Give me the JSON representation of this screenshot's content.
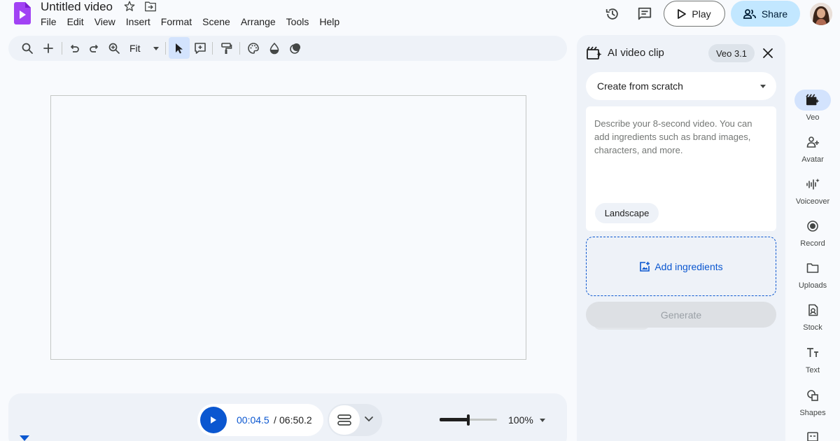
{
  "document": {
    "title": "Untitled video"
  },
  "menu": [
    "File",
    "Edit",
    "View",
    "Insert",
    "Format",
    "Scene",
    "Arrange",
    "Tools",
    "Help"
  ],
  "header": {
    "play_label": "Play",
    "share_label": "Share"
  },
  "toolbar": {
    "zoom_value": "Fit"
  },
  "playback": {
    "current_time": "00:04.5",
    "separator": "/",
    "total_time": "06:50.2",
    "zoom_percent": "100%",
    "zoom_level": 0.5
  },
  "panel": {
    "title": "AI video clip",
    "model": "Veo 3.1",
    "mode_select": "Create from scratch",
    "prompt_placeholder": "Describe your 8-second video. You can add ingredients such as brand images, characters, and more.",
    "aspect_chip": "Landscape",
    "add_ingredients_label": "Add ingredients",
    "generate_label": "Generate"
  },
  "rail": [
    {
      "label": "Veo",
      "icon": "veo-icon",
      "active": true
    },
    {
      "label": "Avatar",
      "icon": "avatar-add-icon",
      "active": false
    },
    {
      "label": "Voiceover",
      "icon": "voiceover-icon",
      "active": false
    },
    {
      "label": "Record",
      "icon": "record-icon",
      "active": false
    },
    {
      "label": "Uploads",
      "icon": "folder-icon",
      "active": false
    },
    {
      "label": "Stock",
      "icon": "stock-icon",
      "active": false
    },
    {
      "label": "Text",
      "icon": "text-icon",
      "active": false
    },
    {
      "label": "Shapes",
      "icon": "shapes-icon",
      "active": false
    }
  ],
  "colors": {
    "accent": "#0b57d0",
    "share_bg": "#c2e7ff",
    "app_logo": "#a142f4"
  }
}
